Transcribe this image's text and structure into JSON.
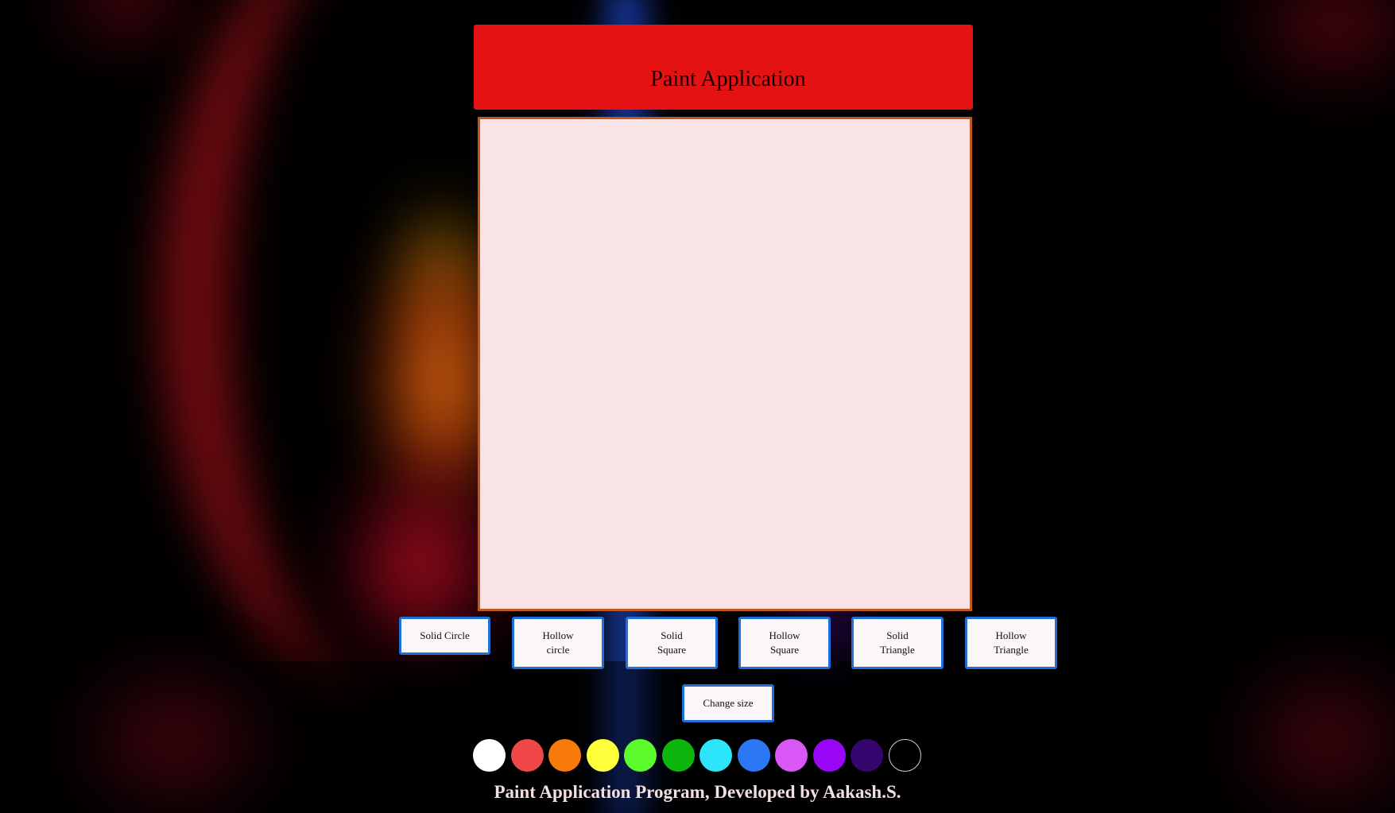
{
  "header": {
    "title": "Paint Application"
  },
  "shape_buttons": [
    {
      "label": "Solid Circle"
    },
    {
      "label": "Hollow circle"
    },
    {
      "label": "Solid Square"
    },
    {
      "label": "Hollow Square"
    },
    {
      "label": "Solid Triangle"
    },
    {
      "label": "Hollow Triangle"
    }
  ],
  "change_size_label": "Change size",
  "palette": [
    {
      "color": "#ffffff",
      "name": "white"
    },
    {
      "color": "#f04848",
      "name": "red"
    },
    {
      "color": "#f77a0a",
      "name": "orange"
    },
    {
      "color": "#ffff3c",
      "name": "yellow"
    },
    {
      "color": "#5dfb2b",
      "name": "light-green"
    },
    {
      "color": "#0cb60c",
      "name": "green"
    },
    {
      "color": "#2de5fb",
      "name": "cyan"
    },
    {
      "color": "#2d76f5",
      "name": "blue"
    },
    {
      "color": "#d957f5",
      "name": "magenta"
    },
    {
      "color": "#9a06f7",
      "name": "purple"
    },
    {
      "color": "#34066e",
      "name": "indigo"
    },
    {
      "color": "#000000",
      "name": "black"
    }
  ],
  "footer": {
    "text": "Paint Application Program, Developed by Aakash.S."
  },
  "colors": {
    "header_bg": "#e41212",
    "canvas_bg": "#f9e3e5",
    "canvas_border": "#c2571b",
    "button_border": "#1f6fd8"
  }
}
